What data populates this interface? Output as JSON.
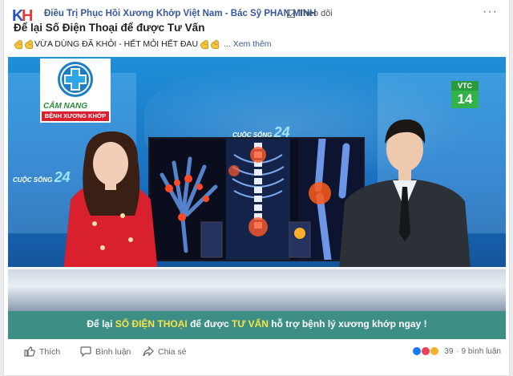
{
  "post": {
    "page_name": "Điều Trị Phục Hồi Xương Khớp Việt Nam - Bác Sỹ PHAN MINH",
    "follow_label": "Theo dõi",
    "more_label": "···",
    "title": "Để lại Số Điện Thoại để được Tư Vấn",
    "text": "VỪA DÙNG ĐÃ KHỎI - HẾT MỎI HẾT ĐAU",
    "see_more": "... Xem thêm",
    "icons": [
      "muscle-emoji"
    ]
  },
  "video": {
    "logo_top": "CẨM NANG",
    "logo_bottom": "BỆNH XƯƠNG KHỚP",
    "channel_top": "VTC",
    "channel_num": "14",
    "show_name": "CUỘC SỐNG",
    "show_num": "24",
    "caption_pre": "Để lại ",
    "caption_hl1": "SỐ ĐIỆN THOẠI",
    "caption_mid": " để được ",
    "caption_hl2": "TƯ VẤN",
    "caption_post": " hỗ trợ bệnh lý xương khớp ngay !"
  },
  "actions": {
    "like_label": "Thích",
    "comment_label": "Bình luận",
    "share_label": "Chia sẻ",
    "reaction_count": "39",
    "comment_count": "· 9 bình luận"
  },
  "colors": {
    "link": "#365899",
    "caption_bg": "#3d8f86",
    "caption_highlight": "#f6e34b"
  }
}
